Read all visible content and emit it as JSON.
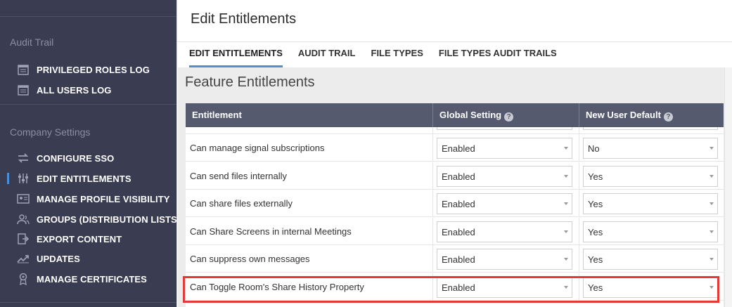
{
  "sidebar": {
    "audit_trail_title": "Audit Trail",
    "audit_items": [
      {
        "label": "PRIVILEGED ROLES LOG",
        "icon": "calendar-icon"
      },
      {
        "label": "ALL USERS LOG",
        "icon": "calendar-icon"
      }
    ],
    "company_settings_title": "Company Settings",
    "company_items": [
      {
        "label": "CONFIGURE SSO",
        "icon": "swap-arrows-icon"
      },
      {
        "label": "EDIT ENTITLEMENTS",
        "icon": "sliders-icon",
        "active": true
      },
      {
        "label": "MANAGE PROFILE VISIBILITY",
        "icon": "id-card-icon"
      },
      {
        "label": "GROUPS (DISTRIBUTION LISTS)",
        "icon": "users-icon"
      },
      {
        "label": "EXPORT CONTENT",
        "icon": "export-icon"
      },
      {
        "label": "UPDATES",
        "icon": "trend-up-icon"
      },
      {
        "label": "MANAGE CERTIFICATES",
        "icon": "certificate-icon"
      }
    ]
  },
  "header": {
    "title": "Edit Entitlements"
  },
  "tabs": [
    {
      "label": "EDIT ENTITLEMENTS",
      "active": true
    },
    {
      "label": "AUDIT TRAIL"
    },
    {
      "label": "FILE TYPES"
    },
    {
      "label": "FILE TYPES AUDIT TRAILS"
    }
  ],
  "section": {
    "heading": "Feature Entitlements"
  },
  "table": {
    "columns": [
      "Entitlement",
      "Global Setting",
      "New User Default"
    ],
    "rows": [
      {
        "name": "Can manage signal subscriptions",
        "global": "Enabled",
        "default": "No"
      },
      {
        "name": "Can send files internally",
        "global": "Enabled",
        "default": "Yes"
      },
      {
        "name": "Can share files externally",
        "global": "Enabled",
        "default": "Yes"
      },
      {
        "name": "Can Share Screens in internal Meetings",
        "global": "Enabled",
        "default": "Yes"
      },
      {
        "name": "Can suppress own messages",
        "global": "Enabled",
        "default": "Yes"
      },
      {
        "name": "Can Toggle Room's Share History Property",
        "global": "Enabled",
        "default": "Yes"
      }
    ]
  },
  "colors": {
    "sidebar_bg": "#3a3d52",
    "table_header_bg": "#565a6e",
    "accent": "#4a90d9",
    "highlight": "#e53935"
  }
}
